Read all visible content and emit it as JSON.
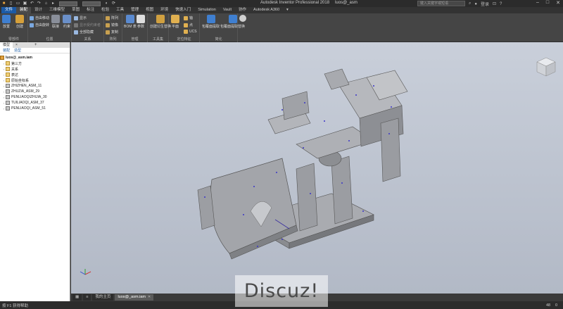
{
  "titlebar": {
    "app_title": "Autodesk Inventor Professional 2018",
    "doc_title": "luos@_asm",
    "search_placeholder": "键入关键字或短语",
    "login_label": "登录"
  },
  "tabs": [
    "文件",
    "装配",
    "设计",
    "三维模型",
    "草图",
    "标注",
    "检验",
    "工具",
    "管理",
    "视图",
    "环境",
    "快速入门",
    "Simulation",
    "Vault",
    "协作",
    "Autodesk A360"
  ],
  "active_tab": "装配",
  "ribbon": {
    "panels": [
      {
        "label": "零部件",
        "tools": [
          "放置",
          "创建"
        ]
      },
      {
        "label": "位置",
        "tools": [
          "自由移动",
          "自由旋转",
          "联接",
          "约束"
        ]
      },
      {
        "label": "关系",
        "tools": [
          "显示",
          "显示受约束者",
          "全部隐藏"
        ]
      },
      {
        "label": "阵列",
        "tools": [
          "阵列",
          "镜像",
          "复制"
        ]
      },
      {
        "label": "管理",
        "tools": [
          "BOM 表",
          "参数"
        ]
      },
      {
        "label": "工具集",
        "tools": [
          "创建衍生替换"
        ]
      },
      {
        "label": "定位特征",
        "tools": [
          "平面",
          "轴",
          "点",
          "UCS"
        ]
      },
      {
        "label": "简化",
        "tools": [
          "包覆面提取",
          "包覆面提取替换"
        ]
      }
    ]
  },
  "browser": {
    "tabs": [
      "模型",
      "+"
    ],
    "subheader": [
      "装配",
      "造型"
    ],
    "root": "luos@_asm.iam",
    "nodes": [
      {
        "label": "第三方",
        "type": "folder"
      },
      {
        "label": "关系",
        "type": "folder"
      },
      {
        "label": "表达",
        "type": "folder"
      },
      {
        "label": "原始坐标系",
        "type": "folder"
      },
      {
        "label": "ZHIZHEN_ASM_11",
        "type": "part"
      },
      {
        "label": "ZHUZIA_ASM_29",
        "type": "part"
      },
      {
        "label": "PENLIAOQIZHIJIA_30",
        "type": "part"
      },
      {
        "label": "TUILIAOQI_ASM_37",
        "type": "part"
      },
      {
        "label": "PENLIAOQI_ASM_51",
        "type": "part"
      }
    ]
  },
  "view_tabs": [
    "我的主页",
    "luos@_asm.iam"
  ],
  "status": {
    "help_text": "按 F1 获得帮助",
    "count1": "48",
    "count2": "0"
  },
  "watermark": "Discuz!",
  "colors": {
    "accent": "#1b5aa6",
    "viewport_top": "#c9cfda",
    "viewport_bottom": "#b2b9c6",
    "model_gray": "#8e9094"
  }
}
